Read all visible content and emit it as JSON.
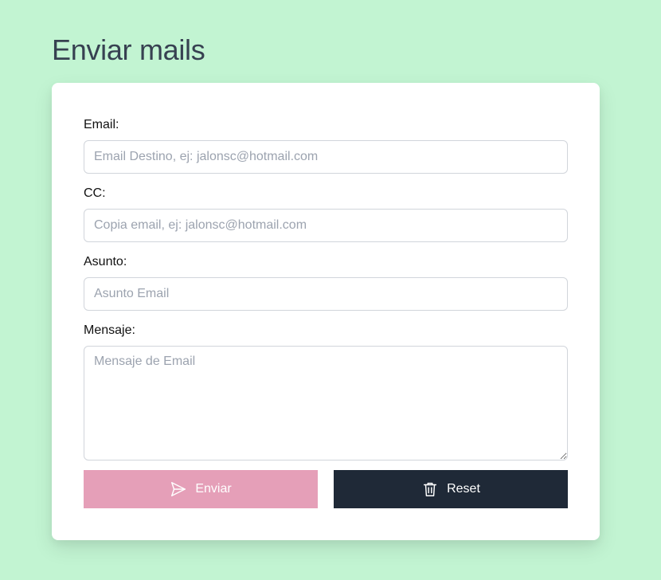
{
  "page": {
    "title": "Enviar mails"
  },
  "form": {
    "email": {
      "label": "Email:",
      "placeholder": "Email Destino, ej: jalonsc@hotmail.com",
      "value": ""
    },
    "cc": {
      "label": "CC:",
      "placeholder": "Copia email, ej: jalonsc@hotmail.com",
      "value": ""
    },
    "subject": {
      "label": "Asunto:",
      "placeholder": "Asunto Email",
      "value": ""
    },
    "message": {
      "label": "Mensaje:",
      "placeholder": "Mensaje de Email",
      "value": ""
    }
  },
  "actions": {
    "send": {
      "label": "Enviar",
      "icon": "paper-plane-icon",
      "color": "#e59fb8"
    },
    "reset": {
      "label": "Reset",
      "icon": "trash-icon",
      "color": "#1f2937"
    }
  },
  "colors": {
    "background": "#c2f4d2",
    "card": "#ffffff",
    "title": "#374151"
  }
}
